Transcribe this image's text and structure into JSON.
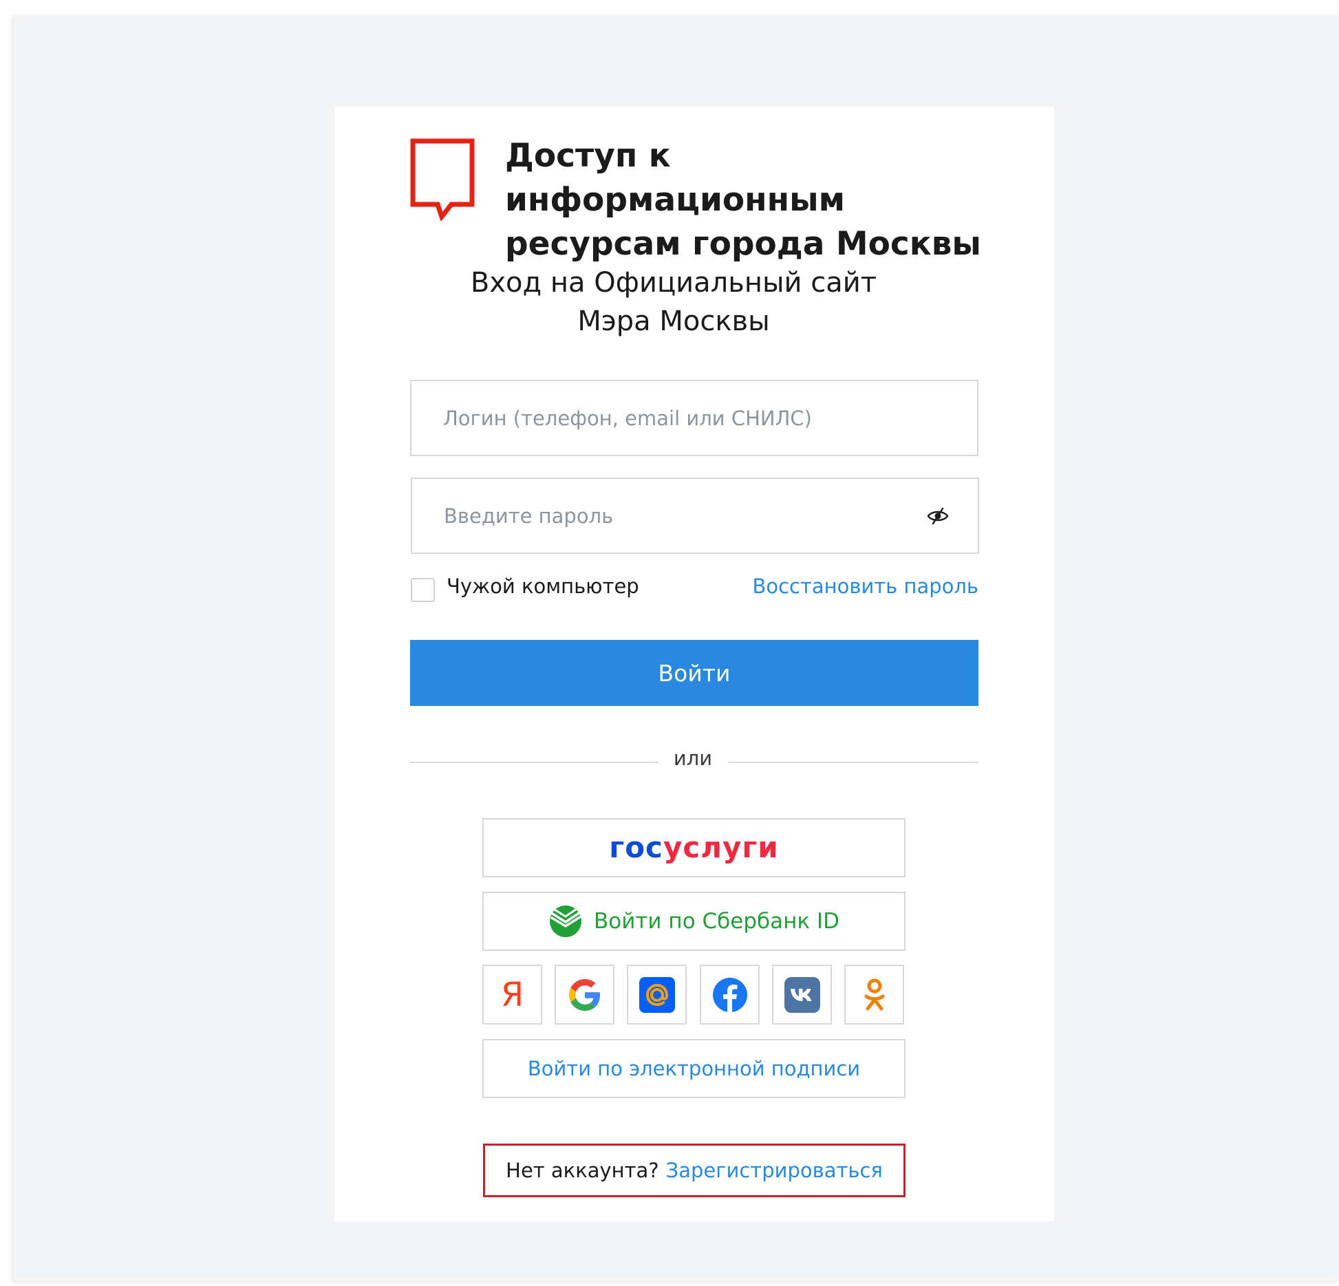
{
  "brand": {
    "title": "Доступ к информационным\nресурсам города Москвы",
    "accent_color": "#e42313"
  },
  "login": {
    "heading": "Вход на Официальный сайт Мэра Москвы",
    "login_placeholder": "Логин (телефон, email или СНИЛС)",
    "password_placeholder": "Введите пароль",
    "password_toggle_icon": "eye-slash-icon",
    "checkbox_label": "Чужой компьютер",
    "checkbox_checked": false,
    "forgot_link": "Восстановить пароль",
    "submit_label": "Войти",
    "primary_color": "#2889de"
  },
  "divider": {
    "text": "или"
  },
  "providers": {
    "gosuslugi": {
      "part1": "гос",
      "part2": "услуги"
    },
    "sber": {
      "label": "Войти по Сбербанк ID",
      "icon": "sber-icon"
    },
    "social": [
      {
        "name": "yandex",
        "icon": "yandex-icon",
        "glyph": "Я"
      },
      {
        "name": "google",
        "icon": "google-icon"
      },
      {
        "name": "mailru",
        "icon": "mailru-icon"
      },
      {
        "name": "facebook",
        "icon": "facebook-icon"
      },
      {
        "name": "vk",
        "icon": "vk-icon"
      },
      {
        "name": "odnoklassniki",
        "icon": "odnoklassniki-icon"
      }
    ],
    "esign": {
      "label": "Войти по электронной подписи"
    }
  },
  "register": {
    "prompt": "Нет аккаунта?",
    "link": "Зарегистрироваться"
  }
}
